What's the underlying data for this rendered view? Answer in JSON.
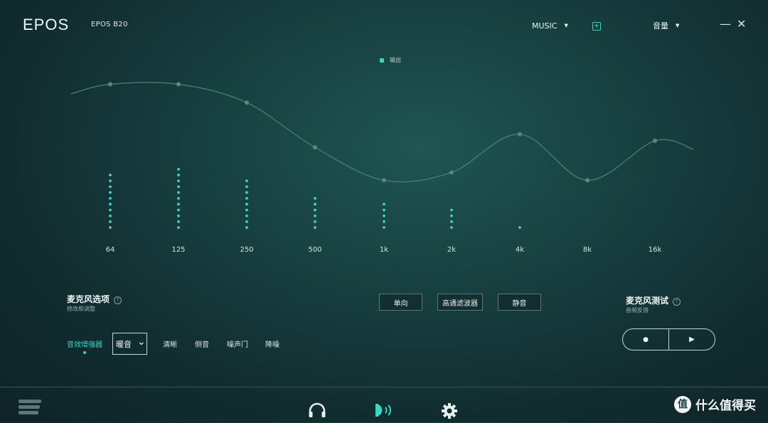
{
  "header": {
    "logo": "EPOS",
    "device": "EPOS B20",
    "preset": "MUSIC",
    "preset_caret": "▼",
    "add_icon": "+",
    "volume_label": "音量",
    "volume_caret": "▼",
    "minimize_icon": "—",
    "close_icon": "✕"
  },
  "chart_data": {
    "type": "line",
    "legend": "输出",
    "x": [
      "64",
      "125",
      "250",
      "500",
      "1k",
      "2k",
      "4k",
      "8k",
      "16k"
    ],
    "curve_levels": [
      0.9,
      0.9,
      0.76,
      0.42,
      0.17,
      0.23,
      0.52,
      0.17,
      0.47
    ],
    "bar_levels": [
      10,
      11,
      9,
      6,
      5,
      4,
      1,
      0,
      0
    ],
    "accent_color": "#3fd3c3",
    "curve_color": "#3e7e78"
  },
  "mic": {
    "title": "麦克风选项",
    "subtitle": "修改和调整",
    "help": "?",
    "buttons": [
      "单向",
      "高通滤波器",
      "静音"
    ],
    "tabs": [
      "音效增强器",
      "清晰",
      "侧音",
      "噪声门",
      "降噪"
    ],
    "select_value": "暖音",
    "select_caret": "⌄"
  },
  "mic_test": {
    "title": "麦克风测试",
    "subtitle": "音频反馈",
    "help": "?",
    "record_icon": "●",
    "play_icon": "▶"
  },
  "bottom": {
    "headphone_icon": "🎧",
    "mic_icon": "◗",
    "gear_icon": "⚙",
    "watermark_text": "什么值得买",
    "watermark_icon": "值"
  }
}
